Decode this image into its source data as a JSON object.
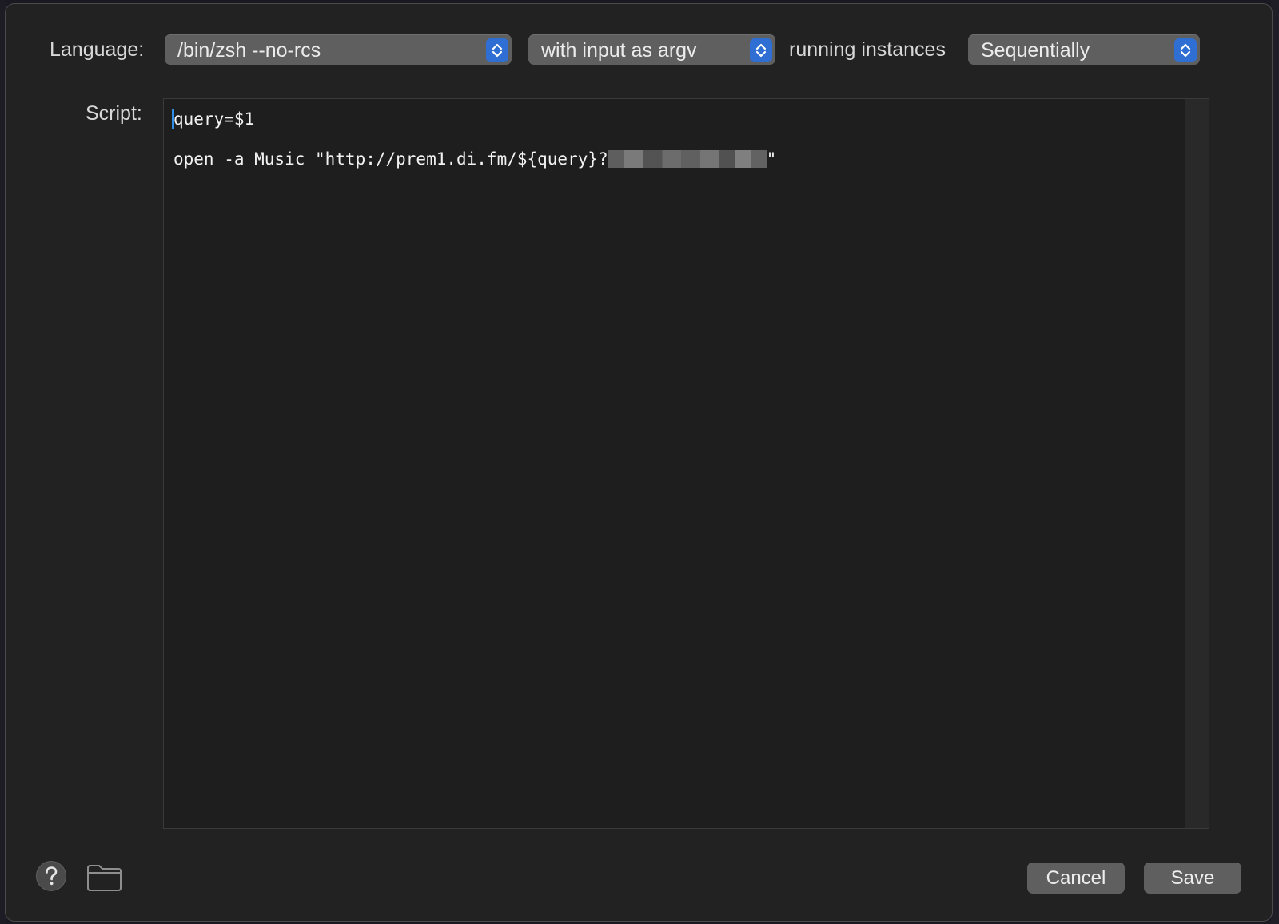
{
  "header": {
    "language_label": "Language:",
    "language_value": "/bin/zsh --no-rcs",
    "input_mode_value": "with input as argv",
    "running_instances_label": "running instances",
    "running_instances_value": "Sequentially"
  },
  "script": {
    "label": "Script:",
    "lines": [
      "query=$1",
      "open -a Music \"http://prem1.di.fm/${query}?",
      "\""
    ]
  },
  "footer": {
    "help_icon": "question-mark-icon",
    "folder_icon": "folder-icon",
    "cancel_label": "Cancel",
    "save_label": "Save"
  },
  "colors": {
    "accent": "#2f6fd4",
    "sheet_background": "#222222",
    "editor_background": "#1e1e1e"
  }
}
